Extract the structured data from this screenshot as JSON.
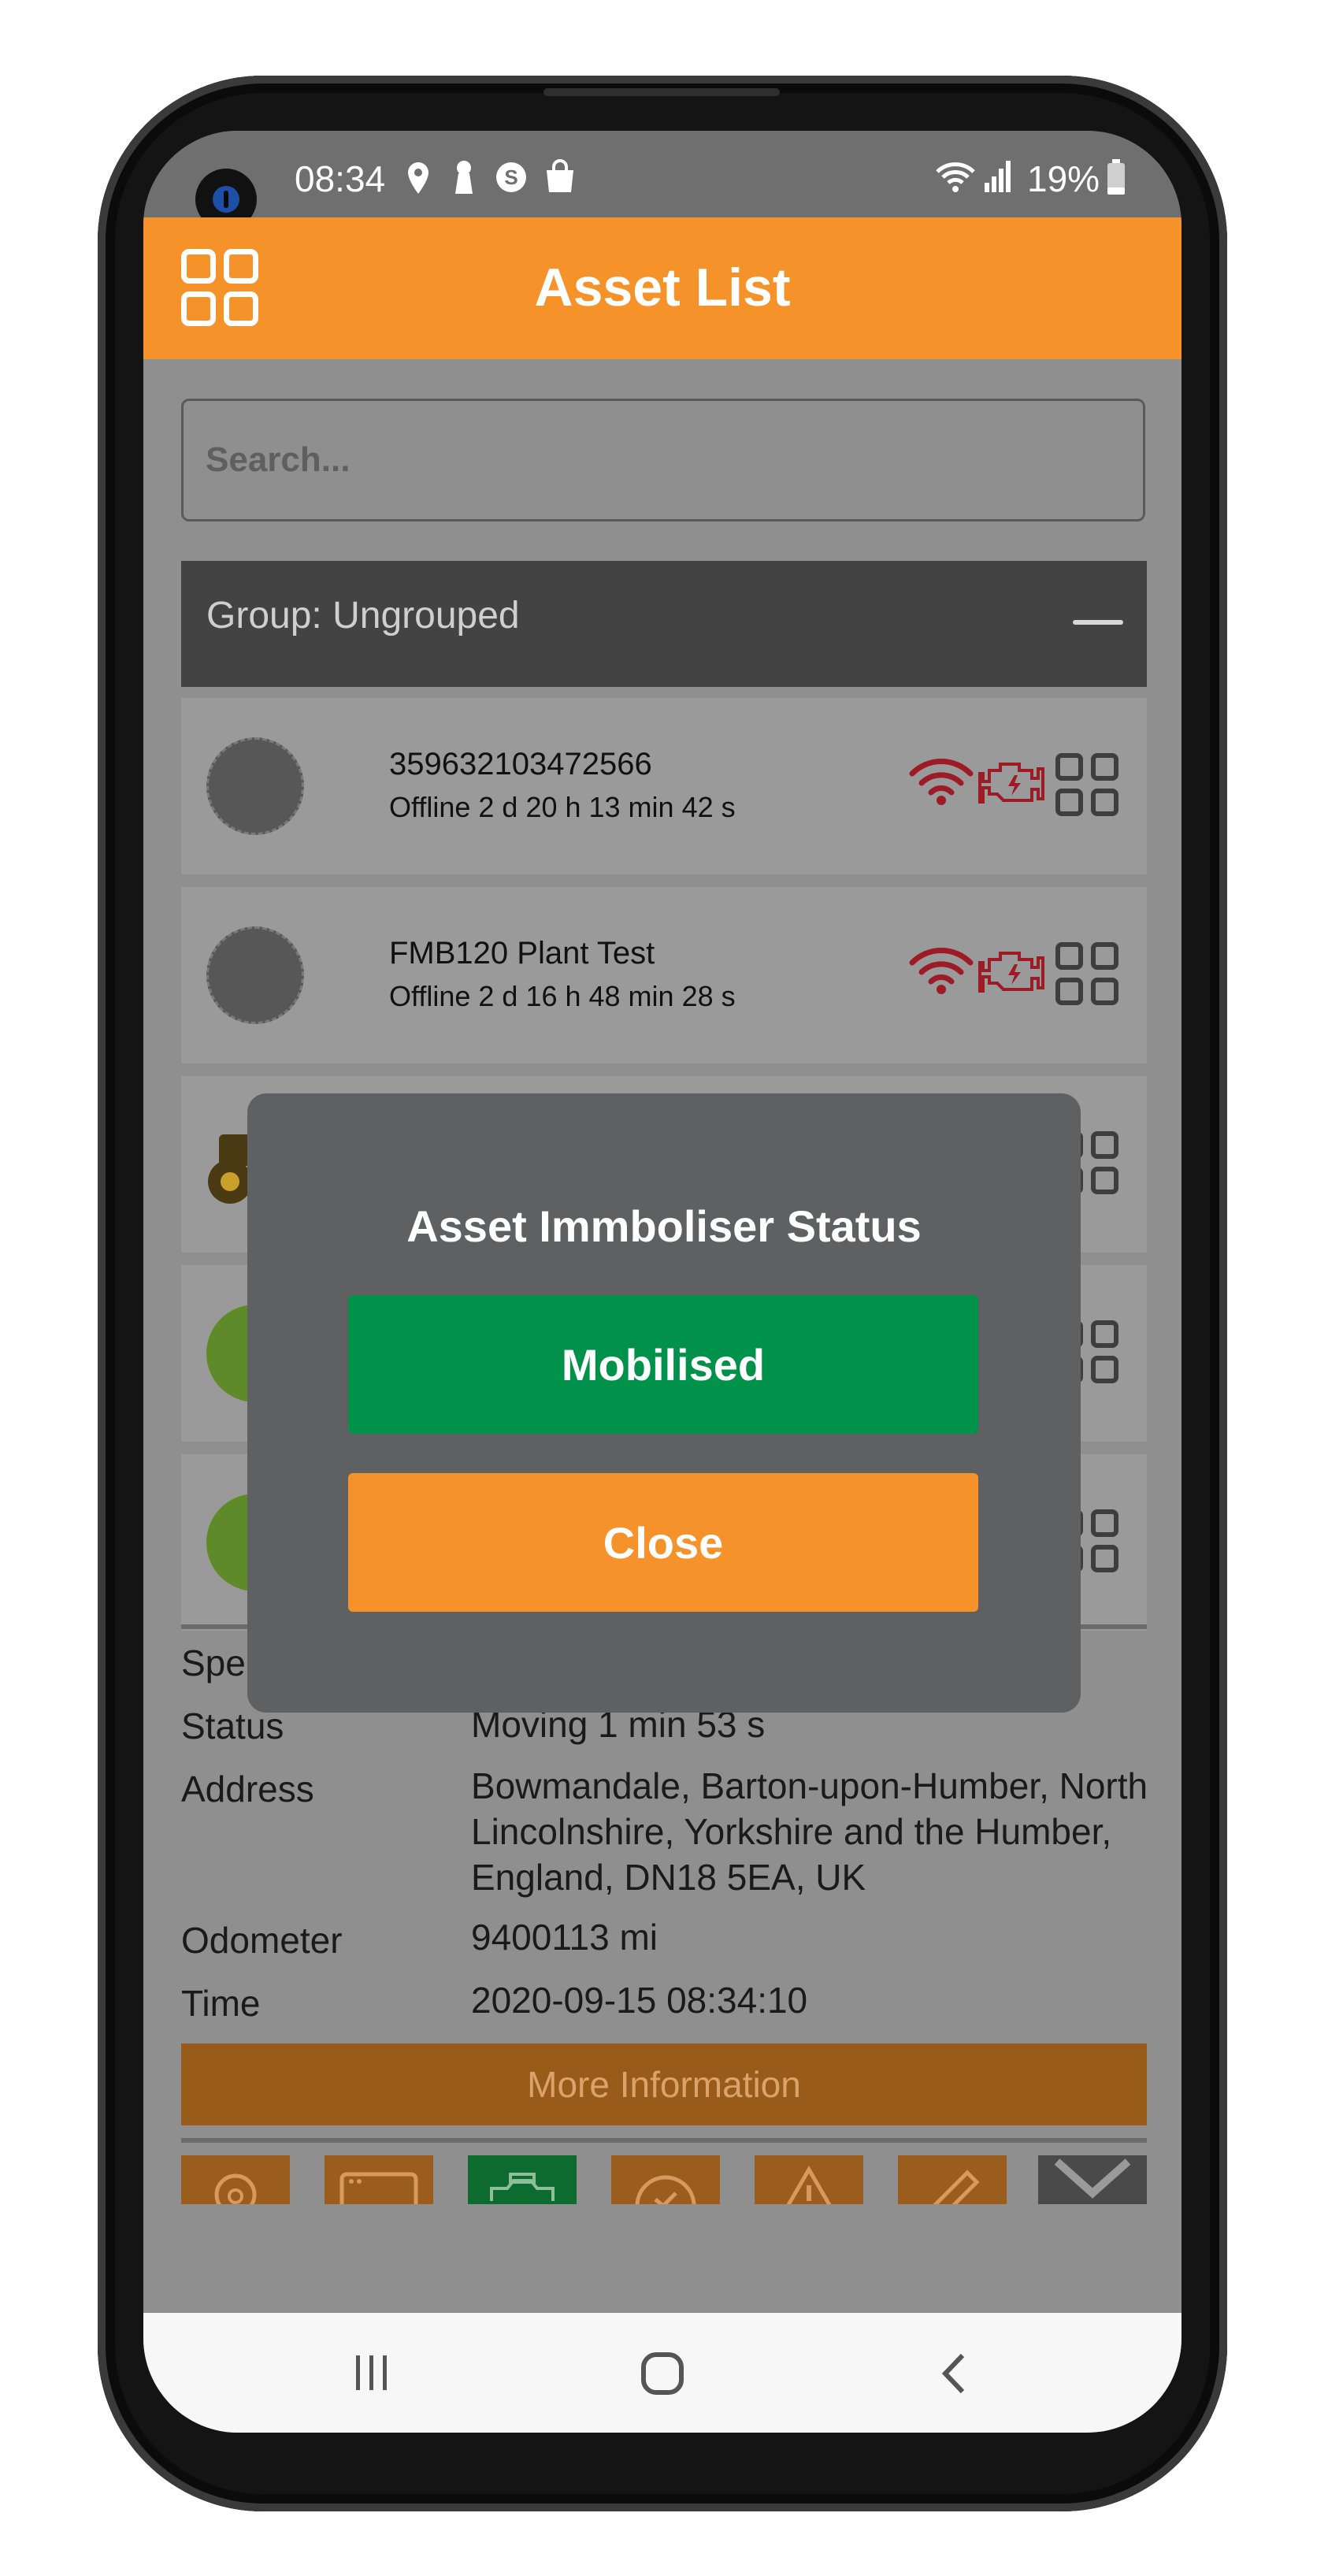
{
  "status_bar": {
    "time": "08:34",
    "battery": "19%",
    "left_icons": [
      "location-icon",
      "keyhole-icon",
      "skype-icon",
      "shopping-bag-icon"
    ],
    "right_icons": [
      "wifi-icon",
      "signal-icon",
      "battery-icon"
    ]
  },
  "header": {
    "title": "Asset List",
    "menu_icon": "grid-menu-icon",
    "background": "#f5922a"
  },
  "search": {
    "placeholder": "Search..."
  },
  "group": {
    "label": "Group: Ungrouped",
    "collapse_icon": "minus-icon"
  },
  "assets": [
    {
      "name": "359632103472566",
      "status": "Offline 2 d 20 h 13 min 42 s",
      "icons": [
        "wifi-alert-icon",
        "engine-icon",
        "grid-icon"
      ]
    },
    {
      "name": "FMB120 Plant Test",
      "status": "Offline 2 d 16 h 48 min 28 s",
      "icons": [
        "wifi-alert-icon",
        "engine-icon",
        "grid-icon"
      ]
    }
  ],
  "details": {
    "speed_label_partial": "Spe",
    "status_label": "Status",
    "status_value": "Moving 1 min 53 s",
    "address_label": "Address",
    "address_value": "Bowmandale, Barton-upon-Humber, North Lincolnshire, Yorkshire and the Humber, England, DN18 5EA, UK",
    "odometer_label": "Odometer",
    "odometer_value": "9400113 mi",
    "time_label": "Time",
    "time_value": "2020-09-15 08:34:10"
  },
  "more_info_button": "More Information",
  "toolbar_icons": [
    "map-pin-icon",
    "browser-icon",
    "vehicle-icon",
    "check-icon",
    "warning-icon",
    "pencil-icon",
    "close-icon"
  ],
  "dialog": {
    "title": "Asset Immboliser Status",
    "status_button": "Mobilised",
    "close_button": "Close",
    "status_color": "#00924a"
  },
  "nav_bar": [
    "recent-apps-icon",
    "home-icon",
    "back-icon"
  ]
}
